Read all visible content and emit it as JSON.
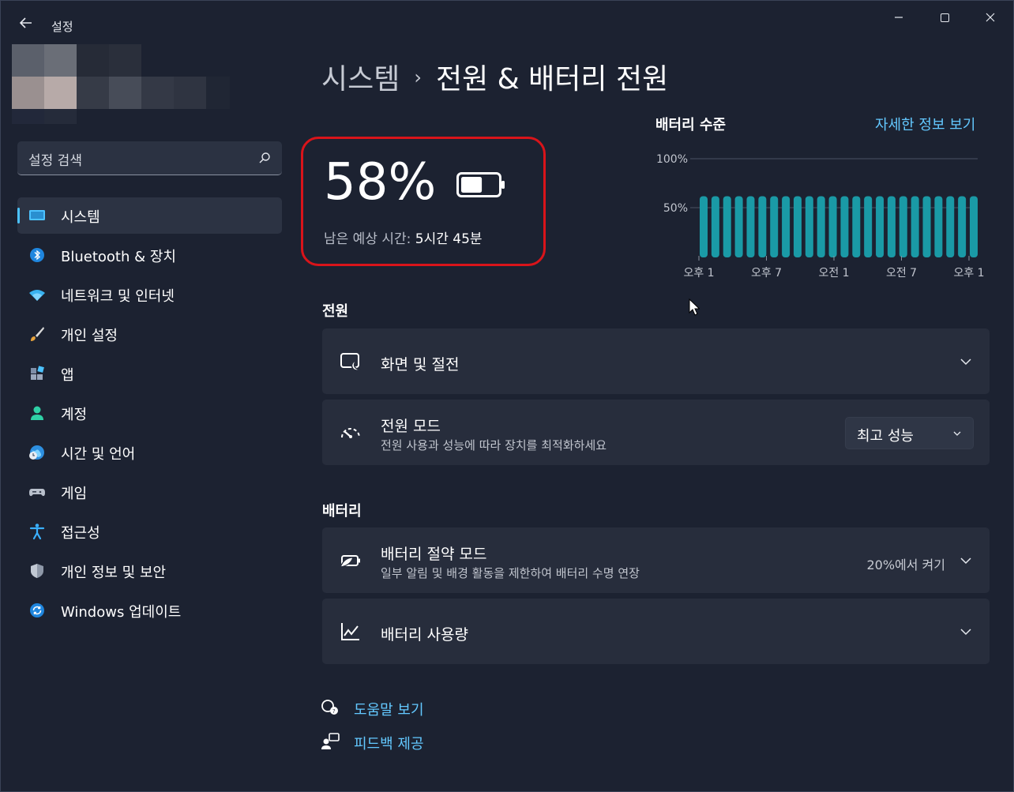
{
  "window": {
    "title": "설정",
    "back_icon": "back-arrow-icon",
    "controls": [
      "minimize-icon",
      "maximize-icon",
      "close-icon"
    ]
  },
  "search": {
    "placeholder": "설정 검색",
    "icon": "search-icon"
  },
  "sidebar": {
    "items": [
      {
        "label": "시스템",
        "icon": "system-display-icon",
        "active": true
      },
      {
        "label": "Bluetooth & 장치",
        "icon": "bluetooth-icon"
      },
      {
        "label": "네트워크 및 인터넷",
        "icon": "wifi-icon"
      },
      {
        "label": "개인 설정",
        "icon": "paintbrush-icon"
      },
      {
        "label": "앱",
        "icon": "apps-icon"
      },
      {
        "label": "계정",
        "icon": "account-icon"
      },
      {
        "label": "시간 및 언어",
        "icon": "time-language-icon"
      },
      {
        "label": "게임",
        "icon": "gamepad-icon"
      },
      {
        "label": "접근성",
        "icon": "accessibility-icon"
      },
      {
        "label": "개인 정보 및 보안",
        "icon": "shield-icon"
      },
      {
        "label": "Windows 업데이트",
        "icon": "windows-update-icon"
      }
    ]
  },
  "breadcrumb": {
    "parent": "시스템",
    "separator": "›",
    "current": "전원 & 배터리 전원"
  },
  "battery": {
    "percent": "58%",
    "level": 0.58,
    "remaining_label": "남은 예상 시간: ",
    "remaining_value": "5시간 45분"
  },
  "battery_chart": {
    "title": "배터리 수준",
    "details_link": "자세한 정보 보기",
    "y_ticks": [
      "100%",
      "50%"
    ],
    "x_ticks": [
      "오후 1",
      "오후 7",
      "오전 1",
      "오전 7",
      "오후 1"
    ]
  },
  "chart_data": {
    "type": "bar",
    "title": "배터리 수준",
    "ylim": [
      0,
      100
    ],
    "yticks": [
      "100%",
      "50%"
    ],
    "xticks": [
      "오후 1",
      "오후 7",
      "오전 1",
      "오전 7",
      "오후 1"
    ],
    "values": [
      62,
      62,
      62,
      62,
      62,
      62,
      62,
      62,
      62,
      62,
      62,
      62,
      62,
      62,
      62,
      62,
      62,
      62,
      62,
      62,
      62,
      62,
      62,
      62
    ],
    "color": "#1a9aa6",
    "grid": true
  },
  "power_section": {
    "title": "전원",
    "screen_sleep": {
      "title": "화면 및 절전",
      "icon": "screen-sleep-icon"
    },
    "power_mode": {
      "title": "전원 모드",
      "subtitle": "전원 사용과 성능에 따라 장치를 최적화하세요",
      "icon": "power-mode-gauge-icon",
      "selected": "최고 성능"
    }
  },
  "battery_section": {
    "title": "배터리",
    "saver": {
      "title": "배터리 절약 모드",
      "subtitle": "일부 알림 및 배경 활동을 제한하여 배터리 수명 연장",
      "status": "20%에서 켜기",
      "icon": "battery-saver-icon"
    },
    "usage": {
      "title": "배터리 사용량",
      "icon": "usage-chart-icon"
    }
  },
  "footer_links": {
    "help": {
      "label": "도움말 보기",
      "icon": "help-icon"
    },
    "feedback": {
      "label": "피드백 제공",
      "icon": "feedback-icon"
    }
  },
  "colors": {
    "accent": "#4cc2ff",
    "link": "#63c8ff",
    "highlight_border": "#d9141a",
    "bar": "#1a9aa6"
  }
}
